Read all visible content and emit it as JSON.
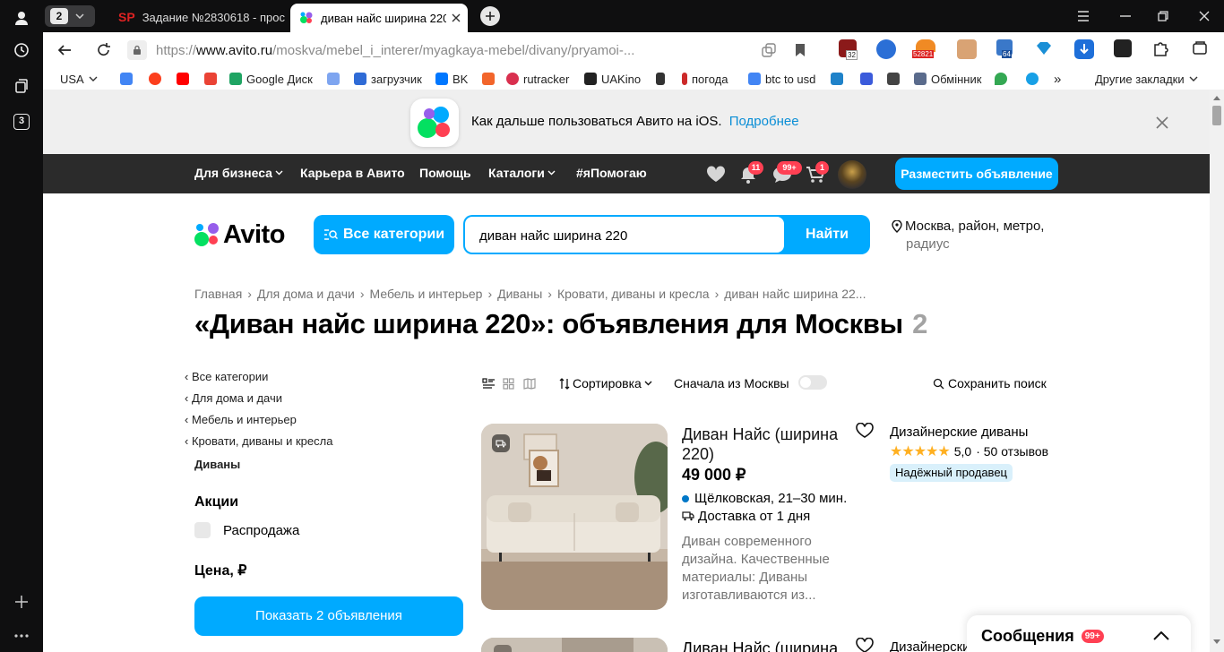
{
  "browser": {
    "sidebar": {
      "tab_count": "3"
    },
    "tabs": [
      {
        "label": "Задание №2830618 - прос"
      },
      {
        "label": "диван найс ширина 220"
      }
    ],
    "tab_group_count": "2",
    "url_prefix": "https://",
    "url_domain": "www.avito.ru",
    "url_path": "/moskva/mebel_i_interer/myagkaya-mebel/divany/pryamoi-...",
    "extension_badges": [
      "32",
      "52821",
      "64"
    ],
    "bookmarks": [
      {
        "label": "USA",
        "color": "#ffffff"
      },
      {
        "label": "",
        "color": "#4285f4"
      },
      {
        "label": "",
        "color": "#fc3f1d"
      },
      {
        "label": "",
        "color": "#ff0000"
      },
      {
        "label": "",
        "color": "#ea4335"
      },
      {
        "label": "Google Диск",
        "color": "#1fa463"
      },
      {
        "label": "",
        "color": "#7ea5f0"
      },
      {
        "label": "загрузчик",
        "color": "#2f6bd6"
      },
      {
        "label": "BK",
        "color": "#0077ff"
      },
      {
        "label": "",
        "color": "#f2652b"
      },
      {
        "label": "rutracker",
        "color": "#d9304f"
      },
      {
        "label": "UAKino",
        "color": "#222222"
      },
      {
        "label": "",
        "color": "#333333"
      },
      {
        "label": "погода",
        "color": "#cc2a2a"
      },
      {
        "label": "btc to usd",
        "color": "#4285f4"
      },
      {
        "label": "",
        "color": "#1f82c9"
      },
      {
        "label": "",
        "color": "#3b5bdb"
      },
      {
        "label": "",
        "color": "#444444"
      },
      {
        "label": "Обмінник",
        "color": "#5a6b8c"
      },
      {
        "label": "",
        "color": "#34a853"
      },
      {
        "label": "",
        "color": "#18a0e6"
      }
    ],
    "bookmarks_more": "»",
    "other_bookmarks": "Другие закладки"
  },
  "banner": {
    "text": "Как дальше пользоваться Авито на iOS.",
    "link": "Подробнее"
  },
  "nav": {
    "items": [
      "Для бизнеса",
      "Карьера в Авито",
      "Помощь",
      "Каталоги",
      "#яПомогаю"
    ],
    "notif_badge": "11",
    "messages_badge": "99+",
    "cart_badge": "1",
    "post_button": "Разместить объявление"
  },
  "header": {
    "logo": "Avito",
    "all_categories": "Все категории",
    "search_value": "диван найс ширина 220",
    "search_button": "Найти",
    "location_line1": "Москва, район, метро,",
    "location_line2": "радиус"
  },
  "breadcrumbs": [
    "Главная",
    "Для дома и дачи",
    "Мебель и интерьер",
    "Диваны",
    "Кровати, диваны и кресла",
    "диван найс ширина 22..."
  ],
  "page_title": "«Диван найс ширина 220»: объявления для Москвы",
  "result_count": "2",
  "sidebar_filters": {
    "links": [
      "Все категории",
      "Для дома и дачи",
      "Мебель и интерьер",
      "Кровати, диваны и кресла"
    ],
    "current": "Диваны",
    "promo_heading": "Акции",
    "sale_checkbox": "Распродажа",
    "price_heading": "Цена, ₽",
    "show_button": "Показать 2 объявления"
  },
  "controls": {
    "sort": "Сортировка",
    "moscow_first": "Сначала из Москвы",
    "save_search": "Сохранить поиск"
  },
  "listings": [
    {
      "title_line1": "Диван Найс (ширина",
      "title_line2": "220)",
      "price": "49 000 ₽",
      "metro": "Щёлковская, 21–30 мин.",
      "delivery": "Доставка от 1 дня",
      "desc": [
        "Диван современного",
        "дизайна. Качественные",
        "материалы: Диваны",
        "изготавливаются из..."
      ],
      "seller": "Дизайнерские диваны",
      "rating": "5,0",
      "reviews": "· 50 отзывов",
      "seller_badge": "Надёжный продавец"
    },
    {
      "title_line1": "Диван Найс (ширина",
      "seller": "Дизайнерские"
    }
  ],
  "messages_widget": {
    "label": "Сообщения",
    "badge": "99+"
  },
  "colors": {
    "accent": "#00aaff",
    "badge": "#ff4053",
    "metro": "#0078c8",
    "star": "#ffb021"
  }
}
